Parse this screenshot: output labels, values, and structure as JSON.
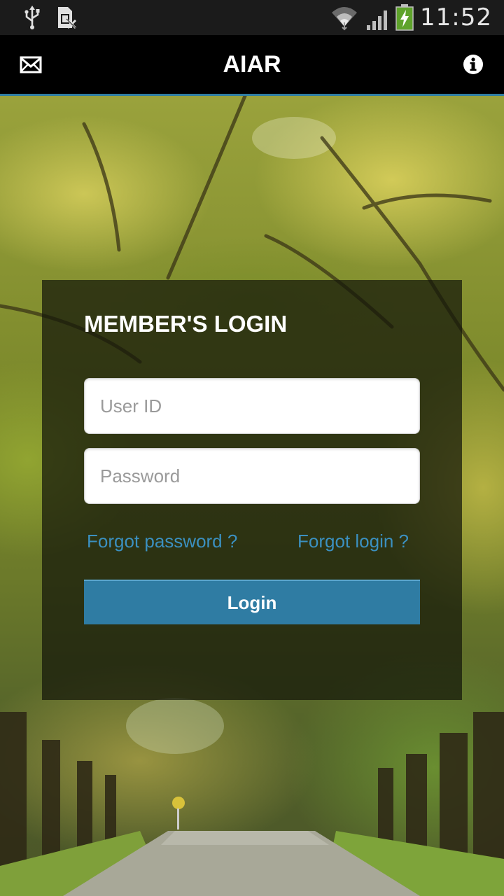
{
  "status_bar": {
    "time": "11:52",
    "icons": [
      "usb-icon",
      "sim-card-icon",
      "wifi-icon",
      "signal-icon",
      "battery-charging-icon"
    ]
  },
  "action_bar": {
    "title": "AIAR",
    "left_icon": "mail-icon",
    "right_icon": "info-icon"
  },
  "login": {
    "heading": "MEMBER'S LOGIN",
    "user_id_placeholder": "User ID",
    "password_placeholder": "Password",
    "forgot_password": "Forgot password ?",
    "forgot_login": "Forgot login ?",
    "login_button": "Login"
  },
  "colors": {
    "accent": "#2f7ca3",
    "link": "#3b90c0",
    "action_bar": "#000000",
    "status_bar": "#1b1b1b"
  }
}
